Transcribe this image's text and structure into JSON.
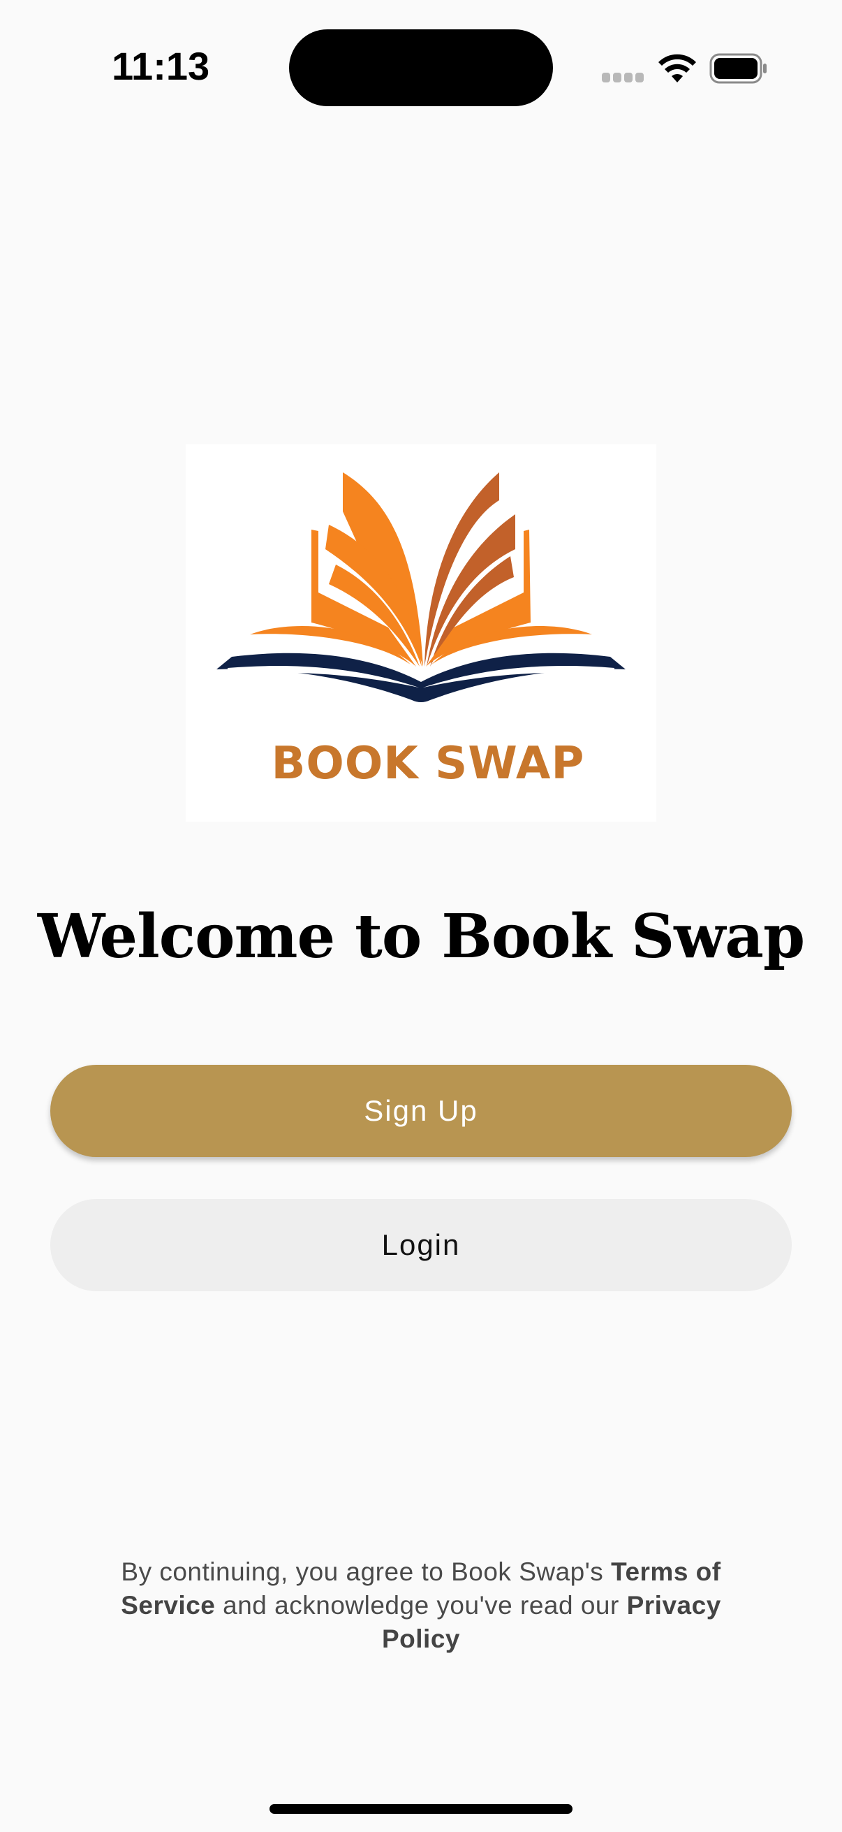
{
  "status_bar": {
    "time": "11:13",
    "icons": [
      "cellular-signal-icon",
      "wifi-icon",
      "battery-icon"
    ]
  },
  "logo": {
    "text": "BOOK SWAP",
    "colors": {
      "orange": "#f5841f",
      "dark_orange": "#c2612a",
      "navy": "#0f2147",
      "text": "#c8772c"
    }
  },
  "welcome": {
    "title": "Welcome to Book Swap"
  },
  "actions": {
    "signup_label": "Sign Up",
    "login_label": "Login"
  },
  "legal": {
    "prefix": "By continuing, you agree to Book Swap's ",
    "terms": "Terms of Service",
    "middle": " and acknowledge you've read our ",
    "privacy": "Privacy Policy"
  },
  "colors": {
    "background": "#fafafa",
    "signup_button": "#b89551",
    "login_button": "#eeeeee"
  }
}
